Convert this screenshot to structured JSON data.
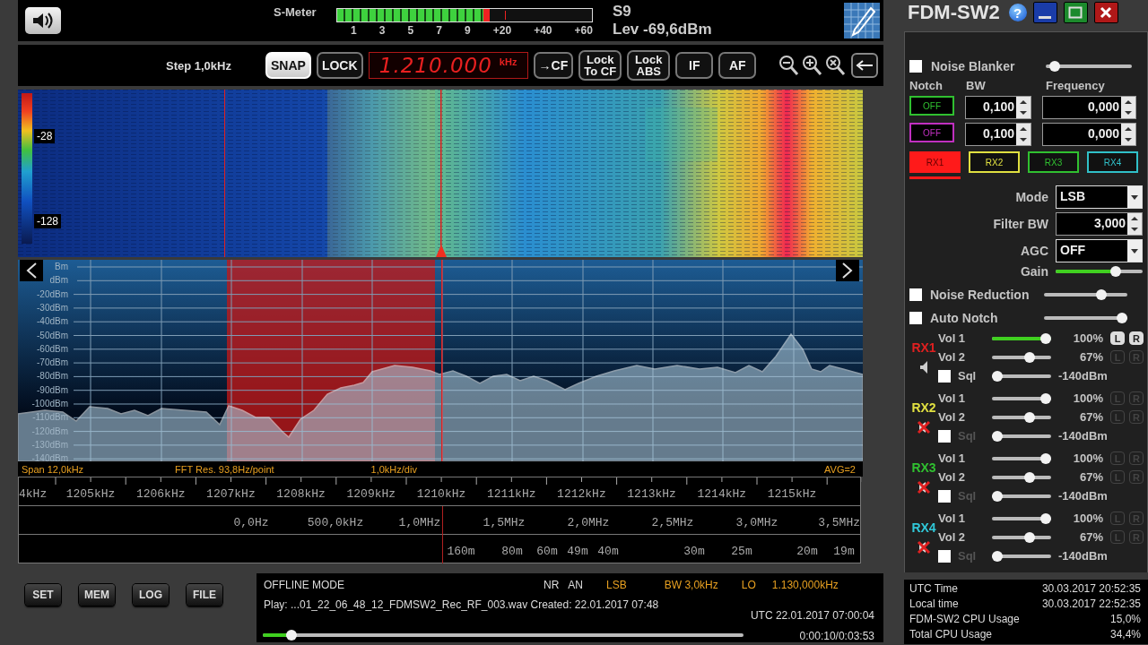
{
  "top_bar": {
    "smeter_label": "S-Meter",
    "smeter": {
      "level": 0.6,
      "scale": [
        "1",
        "3",
        "5",
        "7",
        "9",
        "+20",
        "+40",
        "+60"
      ]
    },
    "s_reading": "S9",
    "level_reading": "Lev -69,6dBm"
  },
  "toolbar": {
    "step": "Step 1,0kHz",
    "buttons_left": [
      {
        "label": "SNAP",
        "selected": true
      },
      {
        "label": "LOCK",
        "selected": false
      }
    ],
    "frequency": "1.210.000",
    "frequency_unit": "kHz",
    "buttons_right": [
      {
        "label": "→CF",
        "selected": false
      },
      {
        "label": "Lock To CF",
        "selected": false
      },
      {
        "label": "Lock ABS",
        "selected": false
      },
      {
        "label": "IF",
        "selected": false
      },
      {
        "label": "AF",
        "selected": false
      }
    ]
  },
  "waterfall": {
    "scale": [
      "-28",
      "-128"
    ]
  },
  "spectrum": {
    "y_labels": [
      "Bm",
      "dBm",
      "-20dBm",
      "-30dBm",
      "-40dBm",
      "-50dBm",
      "-60dBm",
      "-70dBm",
      "-80dBm",
      "-90dBm",
      "-100dBm",
      "-110dBm",
      "-120dBm",
      "-130dBm",
      "-140dBm"
    ],
    "span": "Span 12,0kHz",
    "fft": "FFT Res. 93,8Hz/point",
    "div": "1,0kHz/div",
    "avg": "AVG=2"
  },
  "scales": {
    "khz": [
      "4kHz",
      "1205kHz",
      "1206kHz",
      "1207kHz",
      "1208kHz",
      "1209kHz",
      "1210kHz",
      "1211kHz",
      "1212kHz",
      "1213kHz",
      "1214kHz",
      "1215kHz"
    ],
    "mhz": [
      "0,0Hz",
      "500,0kHz",
      "1,0MHz",
      "1,5MHz",
      "2,0MHz",
      "2,5MHz",
      "3,0MHz",
      "3,5MHz"
    ],
    "bands": [
      "160m",
      "80m",
      "60m",
      "49m",
      "40m",
      "30m",
      "25m",
      "20m",
      "19m"
    ]
  },
  "bottom": {
    "buttons": [
      "SET",
      "MEM",
      "LOG",
      "FILE"
    ],
    "mode": "OFFLINE MODE",
    "flags": [
      "NR",
      "AN"
    ],
    "demod": "LSB",
    "bw": "BW 3,0kHz",
    "lo_label": "LO",
    "lo": "1.130,000kHz",
    "file": "Play: ...01_22_06_48_12_FDMSW2_Rec_RF_003.wav Created: 22.01.2017 07:48",
    "utc": "UTC 22.01.2017 07:00:04",
    "playback": {
      "level": 0.05
    },
    "time": "0:00:10/0:03:53"
  },
  "panel": {
    "title": "FDM-SW2",
    "help": "?",
    "noise_blanker": {
      "label": "Noise Blanker",
      "checked": false,
      "level": 0.05
    },
    "notch_headers": [
      "Notch",
      "BW",
      "Frequency"
    ],
    "notches": [
      {
        "state": "OFF",
        "color": "#30c030",
        "bw": "0,100",
        "frequency": "0,000"
      },
      {
        "state": "OFF",
        "color": "#c030c0",
        "bw": "0,100",
        "frequency": "0,000"
      }
    ],
    "rx_tabs": [
      {
        "label": "RX1",
        "color": "#ff1a1a",
        "selected": true
      },
      {
        "label": "RX2",
        "color": "#e0e040",
        "selected": false
      },
      {
        "label": "RX3",
        "color": "#30c030",
        "selected": false
      },
      {
        "label": "RX4",
        "color": "#30c0c8",
        "selected": false
      }
    ],
    "mode": {
      "label": "Mode",
      "value": "LSB"
    },
    "filter_bw": {
      "label": "Filter BW",
      "value": "3,000"
    },
    "agc": {
      "label": "AGC",
      "value": "OFF"
    },
    "gain": {
      "label": "Gain",
      "level": 0.72
    },
    "noise_reduction": {
      "label": "Noise Reduction",
      "checked": false,
      "level": 0.72
    },
    "auto_notch": {
      "label": "Auto Notch",
      "checked": false,
      "level": 1
    },
    "receivers": [
      {
        "label": "RX1",
        "color": "#e02020",
        "muted": false,
        "vol1": {
          "label": "Vol 1",
          "level": 1,
          "reading": "100%",
          "channels": [
            {
              "label": "L",
              "on": true
            },
            {
              "label": "R",
              "on": true
            }
          ]
        },
        "vol2": {
          "label": "Vol 2",
          "level": 0.67,
          "reading": "67%",
          "channels": [
            {
              "label": "L",
              "on": false
            },
            {
              "label": "R",
              "on": false
            }
          ]
        },
        "sql": {
          "label": "Sql",
          "checked": false,
          "level": 0,
          "reading": "-140dBm"
        }
      },
      {
        "label": "RX2",
        "color": "#e0e040",
        "muted": true,
        "vol1": {
          "label": "Vol 1",
          "level": 1,
          "reading": "100%",
          "channels": [
            {
              "label": "L",
              "on": false
            },
            {
              "label": "R",
              "on": false
            }
          ]
        },
        "vol2": {
          "label": "Vol 2",
          "level": 0.67,
          "reading": "67%",
          "channels": [
            {
              "label": "L",
              "on": false
            },
            {
              "label": "R",
              "on": false
            }
          ]
        },
        "sql": {
          "label": "Sql",
          "checked": false,
          "level": 0,
          "reading": "-140dBm"
        }
      },
      {
        "label": "RX3",
        "color": "#30c030",
        "muted": true,
        "vol1": {
          "label": "Vol 1",
          "level": 1,
          "reading": "100%",
          "channels": [
            {
              "label": "L",
              "on": false
            },
            {
              "label": "R",
              "on": false
            }
          ]
        },
        "vol2": {
          "label": "Vol 2",
          "level": 0.67,
          "reading": "67%",
          "channels": [
            {
              "label": "L",
              "on": false
            },
            {
              "label": "R",
              "on": false
            }
          ]
        },
        "sql": {
          "label": "Sql",
          "checked": false,
          "level": 0,
          "reading": "-140dBm"
        }
      },
      {
        "label": "RX4",
        "color": "#30c8d8",
        "muted": true,
        "vol1": {
          "label": "Vol 1",
          "level": 1,
          "reading": "100%",
          "channels": [
            {
              "label": "L",
              "on": false
            },
            {
              "label": "R",
              "on": false
            }
          ]
        },
        "vol2": {
          "label": "Vol 2",
          "level": 0.67,
          "reading": "67%",
          "channels": [
            {
              "label": "L",
              "on": false
            },
            {
              "label": "R",
              "on": false
            }
          ]
        },
        "sql": {
          "label": "Sql",
          "checked": false,
          "level": 0,
          "reading": "-140dBm"
        }
      }
    ],
    "status": [
      {
        "label": "UTC Time",
        "value": "30.03.2017 20:52:35"
      },
      {
        "label": "Local time",
        "value": "30.03.2017 22:52:35"
      },
      {
        "label": "FDM-SW2 CPU Usage",
        "value": "15,0%"
      },
      {
        "label": "Total CPU Usage",
        "value": "34,4%"
      }
    ]
  }
}
